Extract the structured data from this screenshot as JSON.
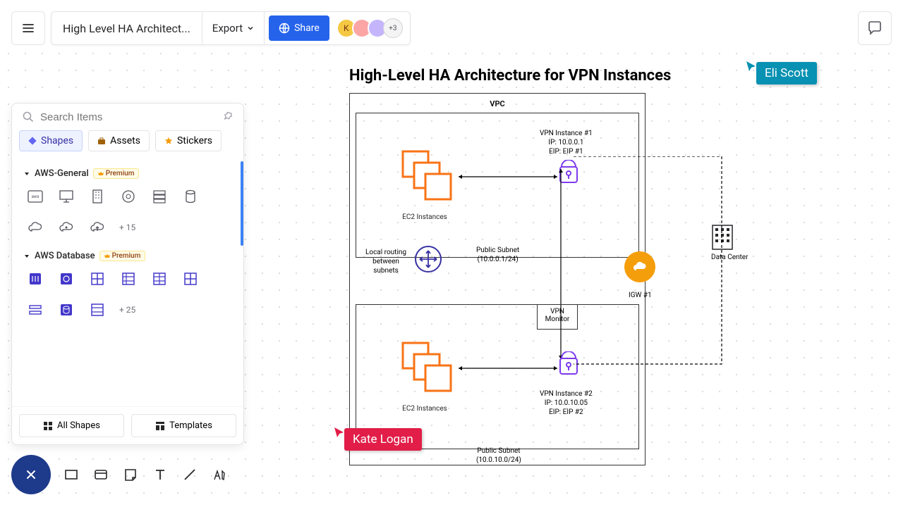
{
  "doc_title": "High Level HA Architect...",
  "export_label": "Export",
  "share_label": "Share",
  "avatar_more": "+3",
  "search_placeholder": "Search Items",
  "pills": {
    "shapes": "Shapes",
    "assets": "Assets",
    "stickers": "Stickers"
  },
  "cat1": {
    "name": "AWS-General",
    "badge": "Premium",
    "more": "+ 15"
  },
  "cat2": {
    "name": "AWS Database",
    "badge": "Premium",
    "more": "+ 25"
  },
  "footer": {
    "all_shapes": "All Shapes",
    "templates": "Templates"
  },
  "diagram": {
    "title": "High-Level HA Architecture for VPN Instances",
    "vpc": "VPC",
    "ec2": "EC2 Instances",
    "vpn1": {
      "l1": "VPN Instance #1",
      "l2": "IP: 10.0.0.1",
      "l3": "EIP: EIP #1"
    },
    "vpn2": {
      "l1": "VPN Instance #2",
      "l2": "IP: 10.0.10.05",
      "l3": "EIP: EIP #2"
    },
    "subnet1": {
      "l1": "Public Subnet",
      "l2": "(10.0.0.1/24)"
    },
    "subnet2": {
      "l1": "Public Subnet",
      "l2": "(10.0.10.0/24)"
    },
    "routing": "Local routing between subnets",
    "vpn_monitor": "VPN Monitor",
    "igw": "IGW #1",
    "datacenter": "Data Center"
  },
  "cursors": {
    "eli": "Eli Scott",
    "kate": "Kate Logan"
  }
}
